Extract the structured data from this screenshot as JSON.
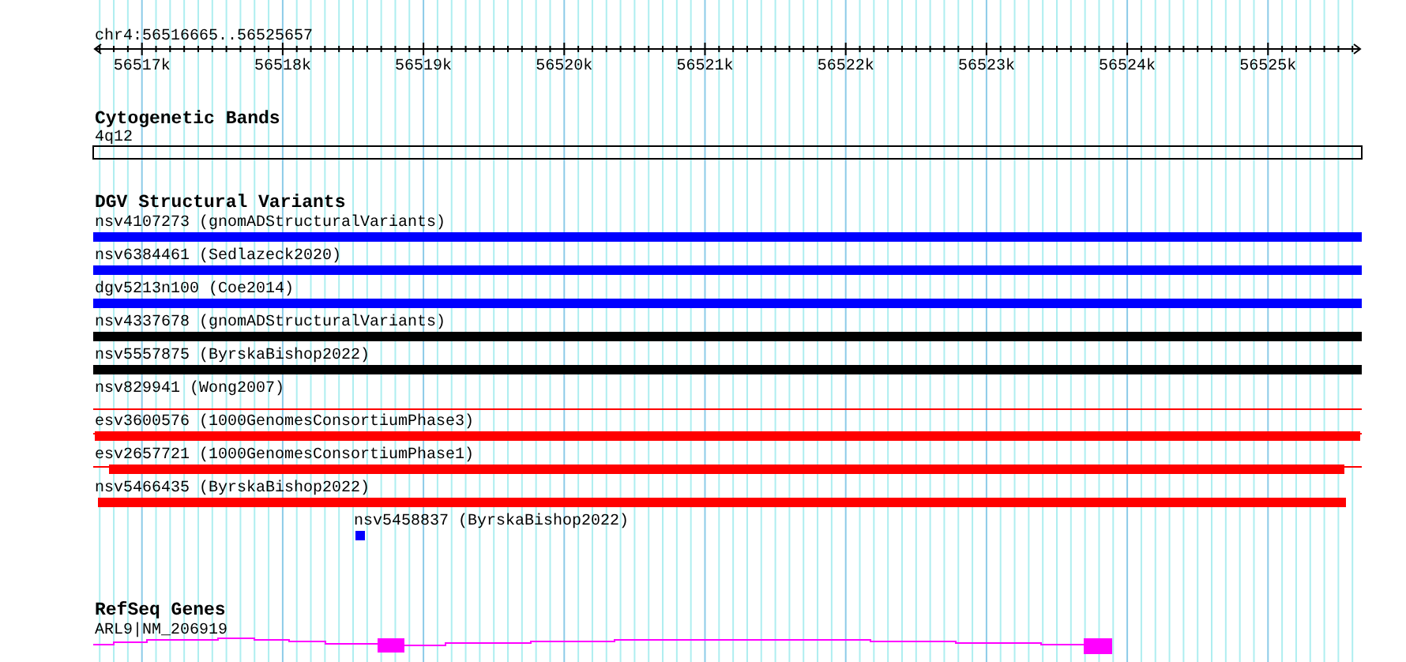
{
  "location": "chr4:56516665..56525657",
  "ruler": {
    "ticks": [
      "56517k",
      "56518k",
      "56519k",
      "56520k",
      "56521k",
      "56522k",
      "56523k",
      "56524k",
      "56525k"
    ]
  },
  "tracks": [
    {
      "title": "Cytogenetic Bands",
      "kind": "bands",
      "features": [
        {
          "label": "4q12"
        }
      ]
    },
    {
      "title": "DGV Structural Variants",
      "kind": "variants",
      "features": [
        {
          "label": "nsv4107273 (gnomADStructuralVariants)",
          "color": "#0000ff",
          "kind": "thick"
        },
        {
          "label": "nsv6384461 (Sedlazeck2020)",
          "color": "#0000ff",
          "kind": "thick"
        },
        {
          "label": "dgv5213n100 (Coe2014)",
          "color": "#0000ff",
          "kind": "thick"
        },
        {
          "label": "nsv4337678 (gnomADStructuralVariants)",
          "color": "#000000",
          "kind": "thick"
        },
        {
          "label": "nsv5557875 (ByrskaBishop2022)",
          "color": "#000000",
          "kind": "thick"
        },
        {
          "label": "nsv829941 (Wong2007)",
          "color": "#ff0000",
          "kind": "thin"
        },
        {
          "label": "esv3600576 (1000GenomesConsortiumPhase3)",
          "color": "#ff0000",
          "kind": "thick"
        },
        {
          "label": "esv2657721 (1000GenomesConsortiumPhase1)",
          "color": "#ff0000",
          "kind": "thick"
        },
        {
          "label": "nsv5466435 (ByrskaBishop2022)",
          "color": "#ff0000",
          "kind": "thick"
        },
        {
          "label": "nsv5458837 (ByrskaBishop2022)",
          "color": "#0000ff",
          "kind": "thick"
        }
      ]
    },
    {
      "title": "RefSeq Genes",
      "kind": "genes",
      "features": [
        {
          "label": "ARL9|NM_206919"
        }
      ]
    }
  ]
}
